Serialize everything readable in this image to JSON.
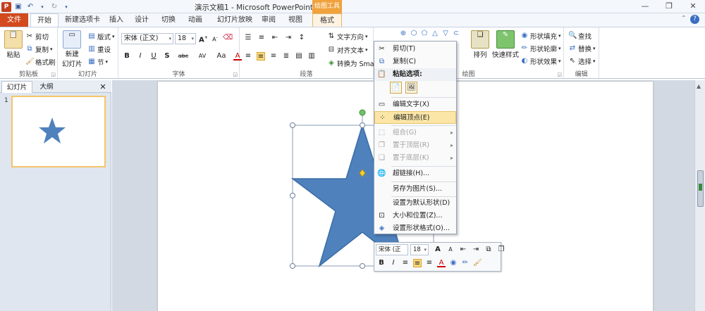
{
  "app": {
    "title": "演示文稿1 - Microsoft PowerPoint",
    "context_tab_header": "绘图工具"
  },
  "tabs": [
    "文件",
    "开始",
    "新建选项卡",
    "插入",
    "设计",
    "切换",
    "动画",
    "幻灯片放映",
    "审阅",
    "视图",
    "格式"
  ],
  "ribbon": {
    "clipboard": {
      "paste": "粘贴",
      "cut": "剪切",
      "copy": "复制",
      "format_painter": "格式刷",
      "label": "剪贴板"
    },
    "slides": {
      "new_slide": "新建",
      "new_slide2": "幻灯片",
      "layout": "版式",
      "reset": "重设",
      "section": "节",
      "label": "幻灯片"
    },
    "font": {
      "name": "宋体 (正文)",
      "size": "18",
      "label": "字体",
      "bold": "B",
      "italic": "I",
      "underline": "U",
      "shadow": "S",
      "strike": "abc",
      "spacing": "AV",
      "case": "Aa",
      "color": "A"
    },
    "paragraph": {
      "text_direction": "文字方向",
      "align_text": "对齐文本",
      "smartart": "转换为 Smar",
      "label": "段落"
    },
    "drawing": {
      "arrange": "排列",
      "quick_styles": "快速样式",
      "fill": "形状填充",
      "outline": "形状轮廓",
      "effects": "形状效果",
      "label": "绘图"
    },
    "editing": {
      "find": "查找",
      "replace": "替换",
      "select": "选择",
      "label": "编辑"
    }
  },
  "pane": {
    "tab_slides": "幻灯片",
    "tab_outline": "大纲",
    "slide_number": "1"
  },
  "context_menu": {
    "cut": "剪切(T)",
    "copy": "复制(C)",
    "paste_options": "粘贴选项:",
    "edit_text": "编辑文字(X)",
    "edit_points": "编辑顶点(E)",
    "group": "组合(G)",
    "bring_front": "置于顶层(R)",
    "send_back": "置于底层(K)",
    "hyperlink": "超链接(H)...",
    "save_as_picture": "另存为图片(S)...",
    "set_default": "设置为默认形状(D)",
    "size_position": "大小和位置(Z)...",
    "format_shape": "设置形状格式(O)..."
  },
  "mini_toolbar": {
    "font": "宋体 (正文)",
    "size": "18",
    "bold": "B",
    "italic": "I",
    "color": "A"
  },
  "colors": {
    "star": "#4f81bd",
    "file_tab": "#d24a1d",
    "menu_highlight": "#fbe6a7",
    "thumb_border": "#f5c469"
  }
}
